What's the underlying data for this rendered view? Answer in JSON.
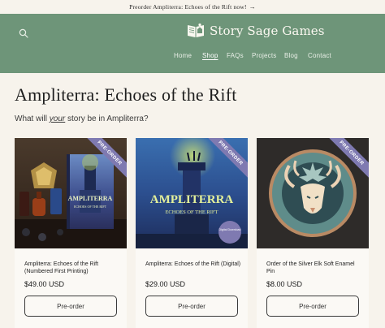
{
  "announcement": {
    "text": "Preorder Ampliterra: Echoes of the Rift now!",
    "arrow": "→"
  },
  "header": {
    "brand_name": "Story Sage Games",
    "nav": [
      {
        "label": "Home",
        "active": false
      },
      {
        "label": "Shop",
        "active": true
      },
      {
        "label": "FAQs",
        "active": false
      },
      {
        "label": "Projects",
        "active": false
      },
      {
        "label": "Blog",
        "active": false
      },
      {
        "label": "Contact",
        "active": false
      }
    ]
  },
  "main": {
    "title": "Ampliterra: Echoes of the Rift",
    "subtitle_before": "What will ",
    "subtitle_em": "your",
    "subtitle_after": " story be in Ampliterra?"
  },
  "products": [
    {
      "badge": "PRE-ORDER",
      "name": "Ampliterra: Echoes of the Rift (Numbered First Printing)",
      "price": "$49.00 USD",
      "button": "Pre-order",
      "book_title": "AMPLITERRA",
      "book_subtitle": "ECHOES OF THE RIFT"
    },
    {
      "badge": "PRE-ORDER",
      "name": "Ampliterra: Echoes of the Rift (Digital)",
      "price": "$29.00 USD",
      "button": "Pre-order",
      "book_title": "AMPLITERRA",
      "book_subtitle": "ECHOES OF THE RIFT",
      "sticker": "Digital Download"
    },
    {
      "badge": "PRE-ORDER",
      "name": "Order of the Silver Elk Soft Enamel Pin",
      "price": "$8.00 USD",
      "button": "Pre-order"
    }
  ],
  "colors": {
    "header_bg": "#6e9579",
    "badge_bg": "#7f7ab1",
    "page_bg": "#f7f3ec"
  }
}
